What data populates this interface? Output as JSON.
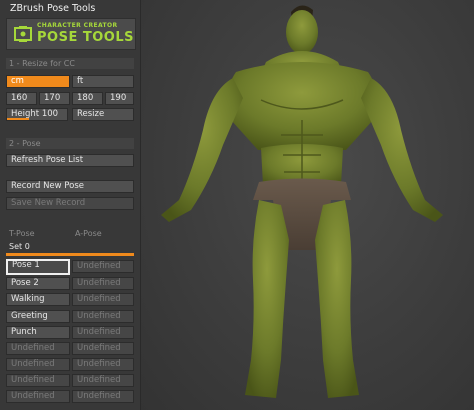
{
  "panel": {
    "title": "ZBrush Pose Tools",
    "banner_sub": "CHARACTER CREATOR",
    "banner_main": "POSE TOOLS",
    "section_resize": "1 - Resize for CC",
    "unit_cm": "cm",
    "unit_ft": "ft",
    "sizes": [
      "160",
      "170",
      "180",
      "190"
    ],
    "height_label": "Height",
    "height_value": "100",
    "resize_button": "Resize",
    "section_pose": "2 - Pose",
    "refresh_button": "Refresh Pose List",
    "record_button": "Record New Pose",
    "save_button": "Save New Record",
    "tpose": "T-Pose",
    "apose": "A-Pose",
    "set_label": "Set",
    "set_value": "0",
    "poses_left": [
      "Pose 1",
      "Pose 2",
      "Walking",
      "Greeting",
      "Punch",
      "Undefined",
      "Undefined",
      "Undefined",
      "Undefined"
    ],
    "poses_right": [
      "Undefined",
      "Undefined",
      "Undefined",
      "Undefined",
      "Undefined",
      "Undefined",
      "Undefined",
      "Undefined",
      "Undefined"
    ],
    "colors": {
      "accent": "#f08a1c",
      "logo": "#a6d83a"
    }
  }
}
